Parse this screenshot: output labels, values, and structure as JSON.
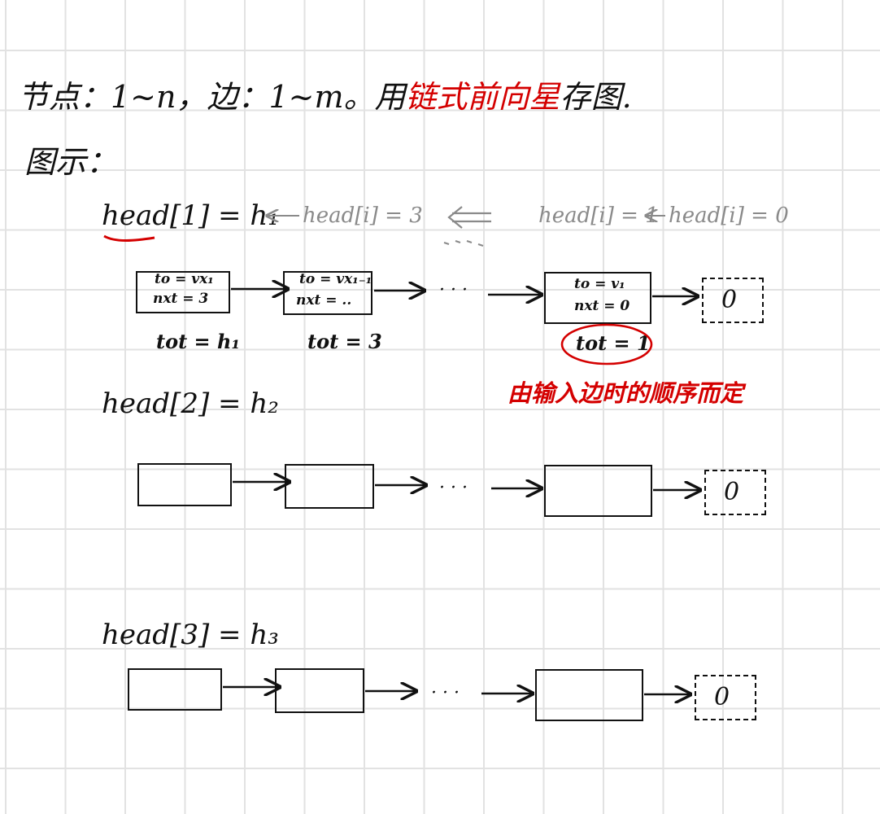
{
  "intro": {
    "prefix": "节点：1~n，边：1~m。用",
    "highlight": "链式前向星",
    "suffix": "存图."
  },
  "legend_label": "图示：",
  "rows": [
    {
      "head_label": "head[1] = h₁",
      "history": [
        "head[i] = 3",
        "head[i] = 1",
        "head[i] = 0"
      ],
      "nodes": [
        {
          "to": "to = vx₁",
          "nxt": "nxt = 3",
          "tot": "tot = h₁"
        },
        {
          "to": "to = vx₁₋₁",
          "nxt": "nxt = ..",
          "tot": "tot = 3"
        },
        {
          "to": "to = v₁",
          "nxt": "nxt = 0",
          "tot": "tot = 1"
        }
      ]
    },
    {
      "head_label": "head[2] = h₂"
    },
    {
      "head_label": "head[3] = h₃"
    }
  ],
  "ellipsis": "· · ·",
  "null_value": "0",
  "note": "由输入边时的顺序而定",
  "colors": {
    "ink": "#111111",
    "accent": "#d40000",
    "pencil": "#8a8a8a",
    "grid": "#e2e2e2"
  }
}
